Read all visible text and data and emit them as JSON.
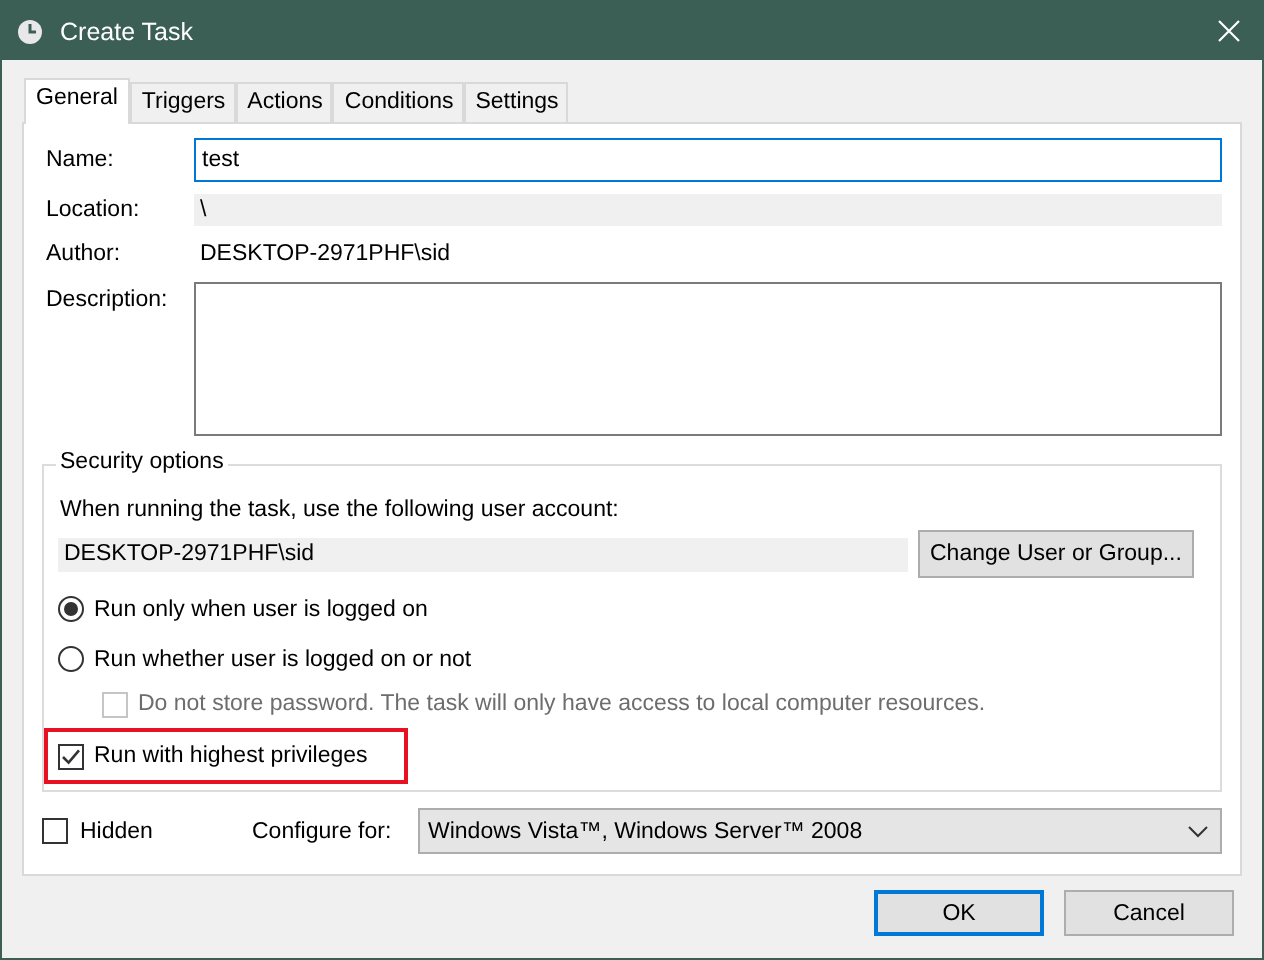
{
  "window": {
    "title": "Create Task"
  },
  "tabs": [
    {
      "label": "General",
      "selected": true
    },
    {
      "label": "Triggers",
      "selected": false
    },
    {
      "label": "Actions",
      "selected": false
    },
    {
      "label": "Conditions",
      "selected": false
    },
    {
      "label": "Settings",
      "selected": false
    }
  ],
  "fields": [
    {
      "kind": "input",
      "label": "Name:",
      "value": "test",
      "focused": true
    },
    {
      "kind": "readonly",
      "label": "Location:",
      "value": "\\"
    },
    {
      "kind": "text",
      "label": "Author:",
      "value": "DESKTOP-2971PHF\\sid"
    },
    {
      "kind": "textarea",
      "label": "Description:"
    }
  ],
  "security": {
    "title": "Security options",
    "account_prompt": "When running the task, use the following user account:",
    "account": "DESKTOP-2971PHF\\sid",
    "change_button": "Change User or Group...",
    "options": [
      {
        "kind": "radio",
        "label": "Run only when user is logged on",
        "selected": true,
        "highlighted": false
      },
      {
        "kind": "radio",
        "label": "Run whether user is logged on or not",
        "selected": false,
        "highlighted": false
      },
      {
        "kind": "checkbox",
        "label": "Do not store password.  The task will only have access to local computer resources.",
        "checked": false,
        "disabled": true,
        "highlighted": false
      },
      {
        "kind": "checkbox",
        "label": "Run with highest privileges",
        "checked": true,
        "disabled": false,
        "highlighted": true
      }
    ]
  },
  "hidden": {
    "label": "Hidden",
    "checked": false
  },
  "configure": {
    "label": "Configure for:",
    "value": "Windows Vista™, Windows Server™ 2008"
  },
  "buttons": [
    {
      "label": "OK",
      "default": true
    },
    {
      "label": "Cancel",
      "default": false
    }
  ]
}
